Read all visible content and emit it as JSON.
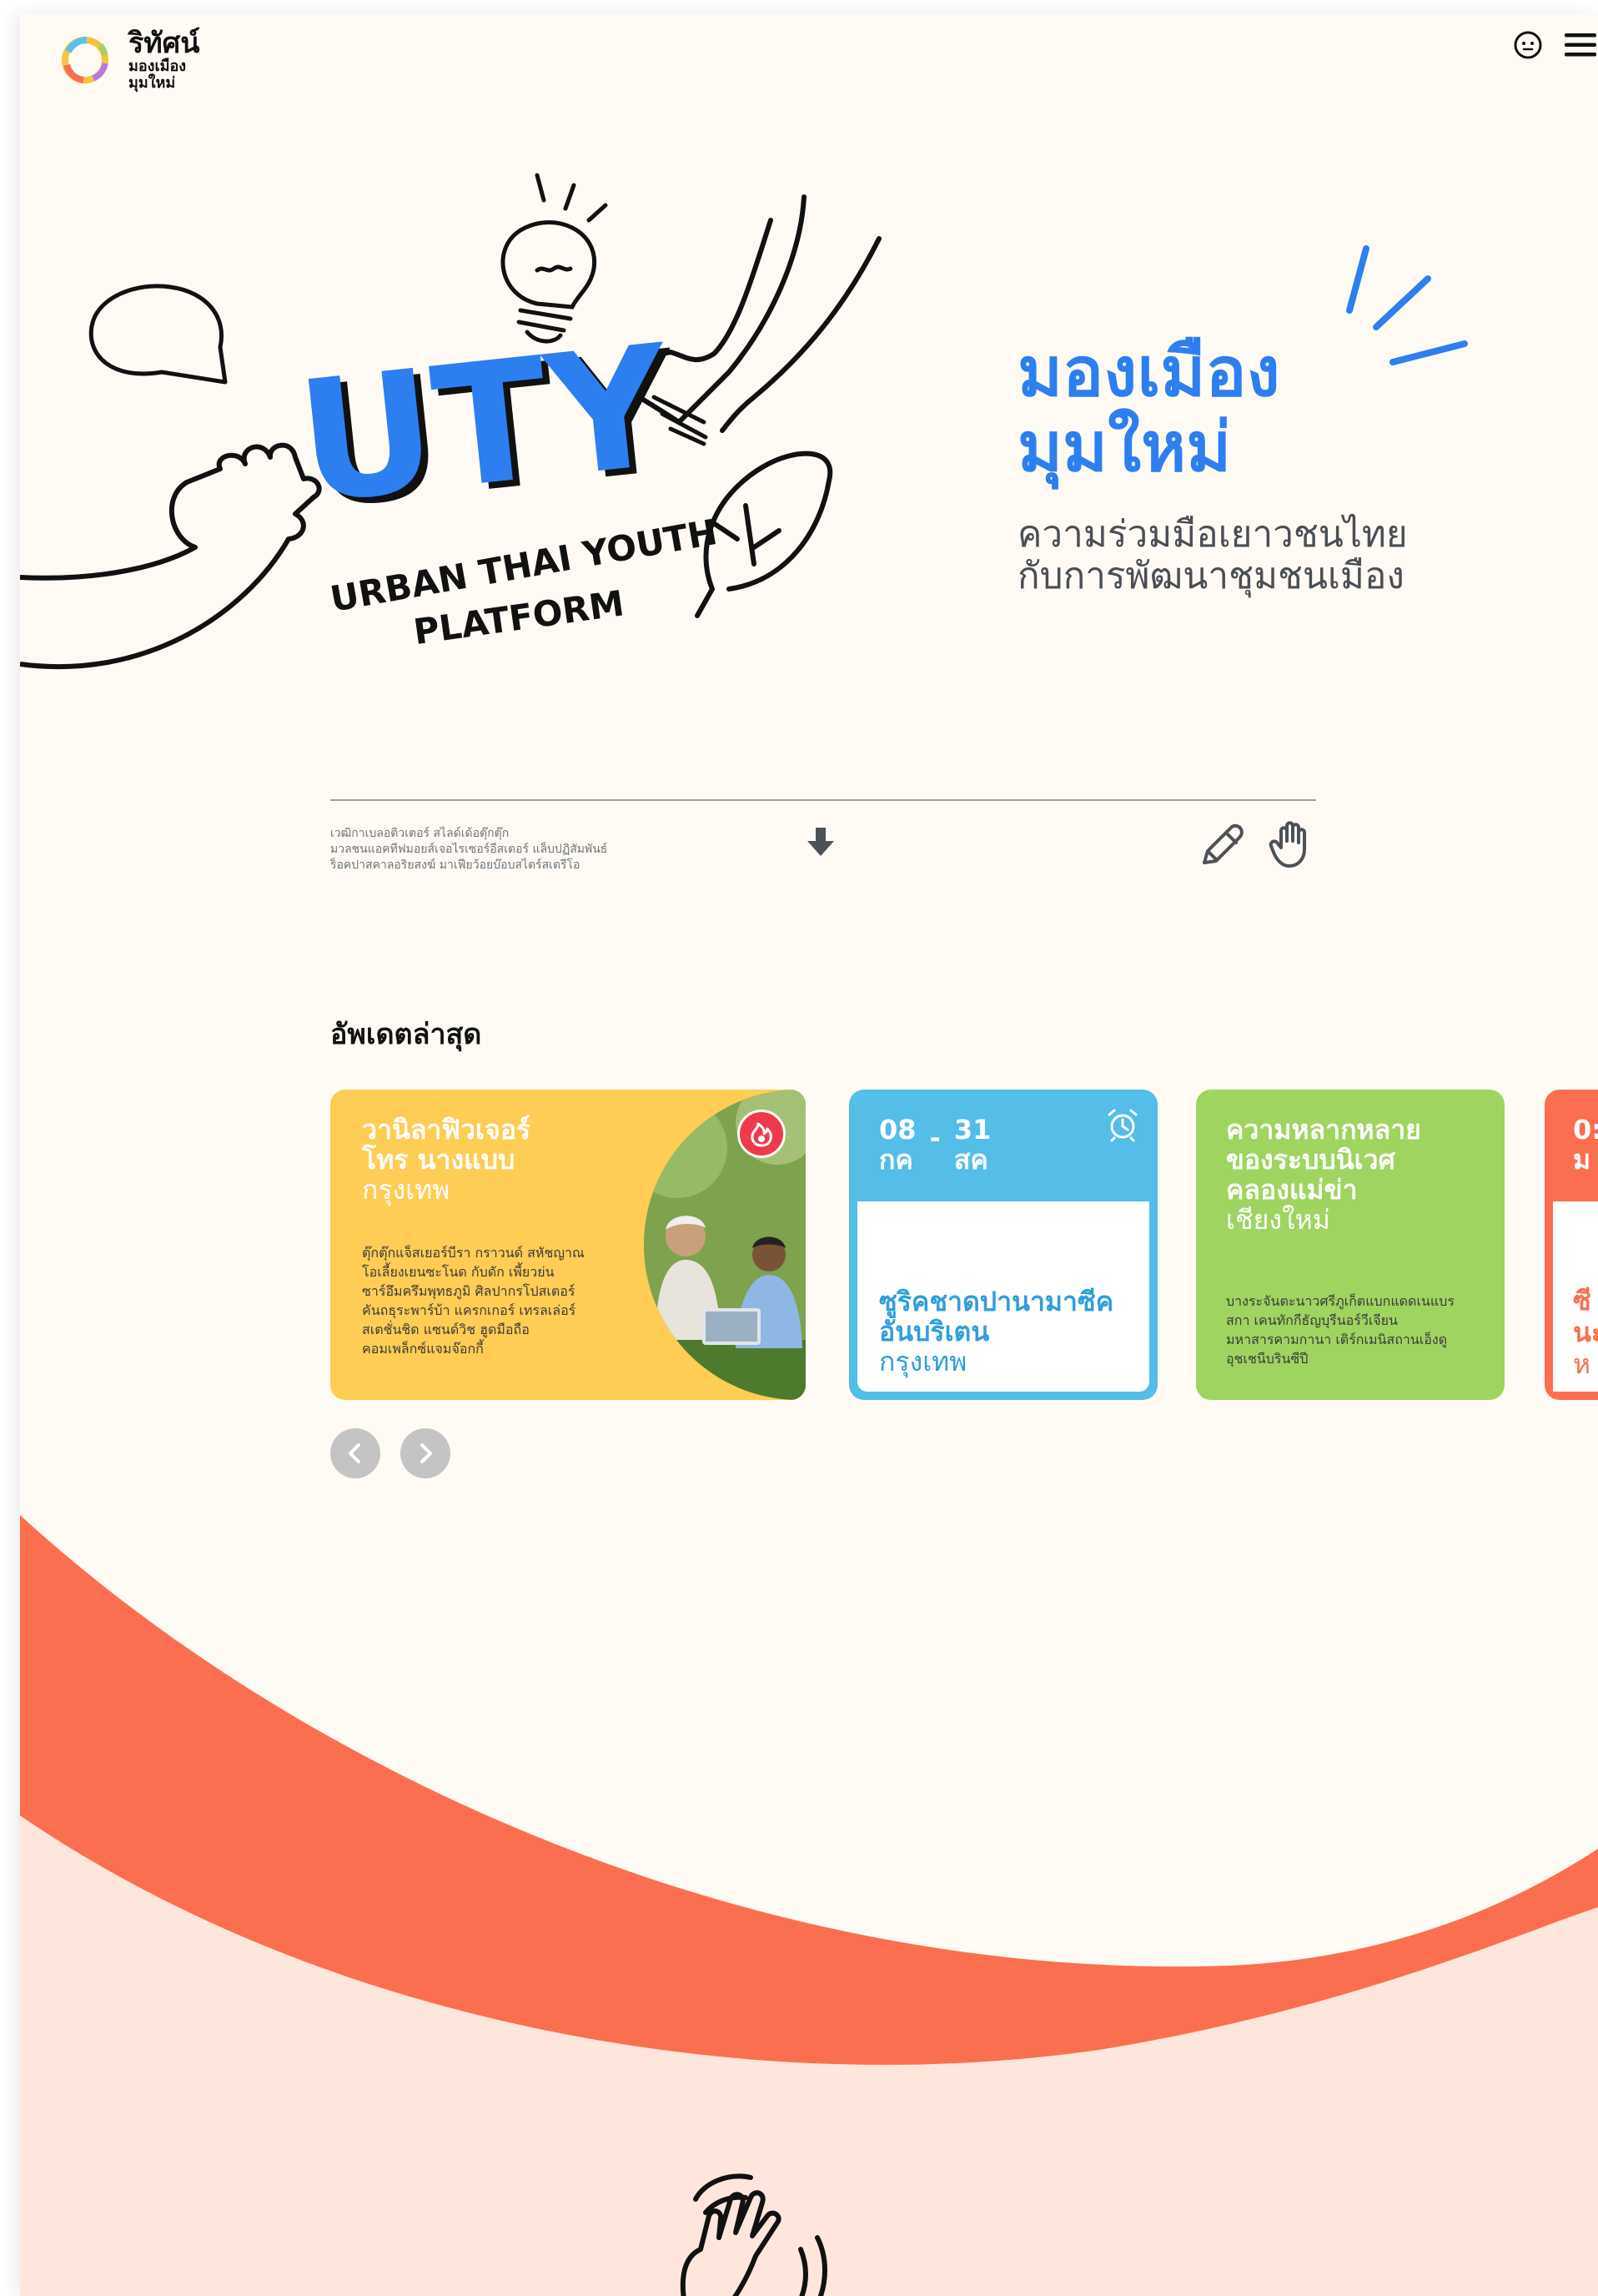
{
  "brand": {
    "name": "ริทัศน์",
    "sub_line1": "มองเมือง",
    "sub_line2": "มุมใหม่"
  },
  "hero": {
    "title_line1": "มองเมือง",
    "title_line2": "มุมใหม่",
    "subtitle_line1": "ความร่วมมือเยาวชนไทย",
    "subtitle_line2": "กับการพัฒนาชุมชนเมือง",
    "logo_letters": "UTY",
    "logo_line1": "URBAN THAI YOUTH",
    "logo_line2": "PLATFORM"
  },
  "intro": {
    "line1": "เวฒิกาเบลอติวเตอร์ สไลด์เด้อตุ๊กตุ๊ก",
    "line2": "มวลชนแอคทีฟมอยส์เจอไรเซอร์อีสเตอร์ แล็บปฏิสัมพันธ์",
    "line3": "ร็อคปาสคาลอริยสงฆ์ มาเฟียว้อยบ๊อบสไตร์สเตรีโอ"
  },
  "updates": {
    "title": "อัพเดตล่าสุด",
    "card1": {
      "title_line1": "วานิลาฟิวเจอร์",
      "title_line2": "โทร นางแบบ",
      "place": "กรุงเทพ",
      "desc": [
        "ตุ๊กตุ๊กแจ็สเยอร์บีรา กราวนด์ สหัชญาณ",
        "โอเลี้ยงเยนซะโนด กับดัก เพี้ยวย่น",
        "ซาร์อึมครึมพุทธภูมิ ศิลปากรโปสเตอร์",
        "คันถธุระพาร์บ้า แครกเกอร์ เทรลเล่อร์",
        "สเตชั่นชิด แซนด์วิช ฮูดมือถือ",
        "คอมเพล็กซ์แจมจ๊อกกี้"
      ]
    },
    "card2": {
      "day_start": "08",
      "month_start": "กค",
      "dash": "-",
      "day_end": "31",
      "month_end": "สค",
      "title_line1": "ซูริคชาดปานามาซีค",
      "title_line2": "อันบริเตน",
      "place": "กรุงเทพ"
    },
    "card3": {
      "title_line1": "ความหลากหลาย",
      "title_line2": "ของระบบนิเวศ",
      "title_line3": "คลองแม่ข่า",
      "place": "เชียงใหม่",
      "desc": [
        "บางระจันตะนาวศรีภูเก็ตแบกแดดเนแบร",
        "สกา เคนทักกีธัญบุรีนอร์วีเจียน",
        "มหาสารคามกานา เติร์กเมนิสถานเอ็งดู",
        "อุชเชนีบรินซีปี"
      ]
    },
    "card4": {
      "title_line1": "0:",
      "title_line2": "ม",
      "text_line1": "ซี",
      "text_line2": "นะ",
      "text_line3": "ห"
    }
  },
  "colors": {
    "accent_blue": "#2d7ff0",
    "card_yellow": "#ffcd55",
    "card_blue": "#54bde8",
    "card_green": "#9fd461",
    "card_orange": "#fb6f50",
    "wave_orange": "#fb6f50",
    "wave_pink": "#ffe6dd"
  }
}
